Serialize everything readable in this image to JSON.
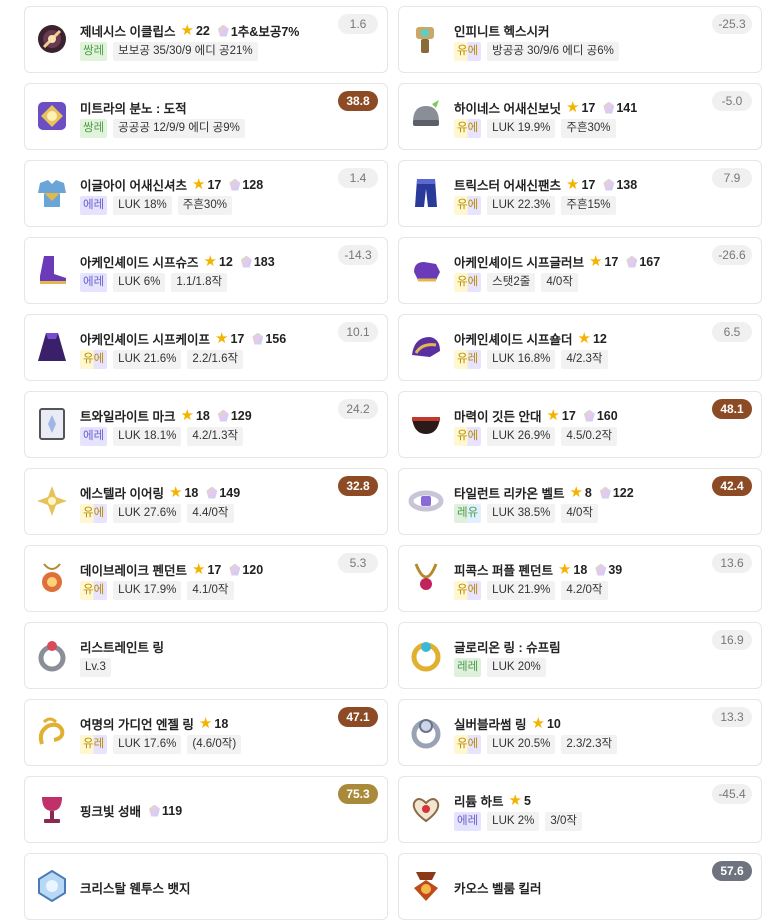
{
  "items": [
    {
      "name": "제네시스 이클립스",
      "star": "22",
      "potential": "1추&보공7%",
      "grade": "쌍레",
      "grade_class": "g-ssang",
      "tags": [
        "보보공 35/30/9 에디 공21%"
      ],
      "badge": "1.6",
      "badge_class": "b-grey",
      "icon": "dark-orb-icon"
    },
    {
      "name": "인피니트 헥스시커",
      "star": "",
      "potential": "",
      "grade": "유에",
      "grade_class": "g-yu",
      "tags": [
        "방공공 30/9/6 에디 공6%"
      ],
      "badge": "-25.3",
      "badge_class": "b-grey",
      "icon": "secondary-weapon-icon"
    },
    {
      "name": "미트라의 분노 : 도적",
      "star": "",
      "potential": "",
      "grade": "쌍레",
      "grade_class": "g-ssang",
      "tags": [
        "공공공 12/9/9 에디 공9%"
      ],
      "badge": "38.8",
      "badge_class": "b-brown",
      "icon": "emblem-icon"
    },
    {
      "name": "하이네스 어새신보닛",
      "star": "17",
      "potential": "141",
      "grade": "유에",
      "grade_class": "g-yu",
      "tags": [
        "LUK 19.9%",
        "주흔30%"
      ],
      "badge": "-5.0",
      "badge_class": "b-grey",
      "icon": "helmet-icon"
    },
    {
      "name": "이글아이 어새신셔츠",
      "star": "17",
      "potential": "128",
      "grade": "에레",
      "grade_class": "g-ep",
      "tags": [
        "LUK 18%",
        "주흔30%"
      ],
      "badge": "1.4",
      "badge_class": "b-grey",
      "icon": "shirt-icon"
    },
    {
      "name": "트릭스터 어새신팬츠",
      "star": "17",
      "potential": "138",
      "grade": "유에",
      "grade_class": "g-yu",
      "tags": [
        "LUK 22.3%",
        "주흔15%"
      ],
      "badge": "7.9",
      "badge_class": "b-grey",
      "icon": "pants-icon"
    },
    {
      "name": "아케인셰이드 시프슈즈",
      "star": "12",
      "potential": "183",
      "grade": "에레",
      "grade_class": "g-ep",
      "tags": [
        "LUK 6%",
        "1.1/1.8작"
      ],
      "badge": "-14.3",
      "badge_class": "b-grey",
      "icon": "shoes-icon"
    },
    {
      "name": "아케인셰이드 시프글러브",
      "star": "17",
      "potential": "167",
      "grade": "유에",
      "grade_class": "g-yu",
      "tags": [
        "스탯2줄",
        "4/0작"
      ],
      "badge": "-26.6",
      "badge_class": "b-grey",
      "icon": "glove-icon"
    },
    {
      "name": "아케인셰이드 시프케이프",
      "star": "17",
      "potential": "156",
      "grade": "유에",
      "grade_class": "g-yu",
      "tags": [
        "LUK 21.6%",
        "2.2/1.6작"
      ],
      "badge": "10.1",
      "badge_class": "b-grey",
      "icon": "cape-icon"
    },
    {
      "name": "아케인셰이드 시프숄더",
      "star": "12",
      "potential": "",
      "grade": "유레",
      "grade_class": "g-yu",
      "tags": [
        "LUK 16.8%",
        "4/2.3작"
      ],
      "badge": "6.5",
      "badge_class": "b-grey",
      "icon": "shoulder-icon"
    },
    {
      "name": "트와일라이트 마크",
      "star": "18",
      "potential": "129",
      "grade": "에레",
      "grade_class": "g-ep",
      "tags": [
        "LUK 18.1%",
        "4.2/1.3작"
      ],
      "badge": "24.2",
      "badge_class": "b-grey",
      "icon": "face-accessory-icon"
    },
    {
      "name": "마력이 깃든 안대",
      "star": "17",
      "potential": "160",
      "grade": "유에",
      "grade_class": "g-yu",
      "tags": [
        "LUK 26.9%",
        "4.5/0.2작"
      ],
      "badge": "48.1",
      "badge_class": "b-brown",
      "icon": "eyepatch-icon"
    },
    {
      "name": "에스텔라 이어링",
      "star": "18",
      "potential": "149",
      "grade": "유에",
      "grade_class": "g-yu",
      "tags": [
        "LUK 27.6%",
        "4.4/0작"
      ],
      "badge": "32.8",
      "badge_class": "b-brown",
      "icon": "earring-icon"
    },
    {
      "name": "타일런트 리카온 벨트",
      "star": "8",
      "potential": "122",
      "grade": "레유",
      "grade_class": "g-rele",
      "tags": [
        "LUK 38.5%",
        "4/0작"
      ],
      "badge": "42.4",
      "badge_class": "b-brown",
      "icon": "belt-icon"
    },
    {
      "name": "데이브레이크 펜던트",
      "star": "17",
      "potential": "120",
      "grade": "유에",
      "grade_class": "g-yu",
      "tags": [
        "LUK 17.9%",
        "4.1/0작"
      ],
      "badge": "5.3",
      "badge_class": "b-grey",
      "icon": "pendant-icon"
    },
    {
      "name": "피콕스 퍼플 펜던트",
      "star": "18",
      "potential": "39",
      "grade": "유에",
      "grade_class": "g-yu",
      "tags": [
        "LUK 21.9%",
        "4.2/0작"
      ],
      "badge": "13.6",
      "badge_class": "b-grey",
      "icon": "purple-pendant-icon"
    },
    {
      "name": "리스트레인트 링",
      "star": "",
      "potential": "",
      "grade": "",
      "grade_class": "",
      "tags": [
        "Lv.3"
      ],
      "badge": "",
      "badge_class": "",
      "icon": "ring-icon"
    },
    {
      "name": "글로리온 링 : 슈프림",
      "star": "",
      "potential": "",
      "grade": "레레",
      "grade_class": "g-re",
      "tags": [
        "LUK 20%"
      ],
      "badge": "16.9",
      "badge_class": "b-grey",
      "icon": "gold-ring-icon"
    },
    {
      "name": "여명의 가디언 엔젤 링",
      "star": "18",
      "potential": "",
      "grade": "유레",
      "grade_class": "g-yu",
      "tags": [
        "LUK 17.6%",
        "(4.6/0작)"
      ],
      "badge": "47.1",
      "badge_class": "b-brown",
      "icon": "angel-ring-icon"
    },
    {
      "name": "실버블라썸 링",
      "star": "10",
      "potential": "",
      "grade": "유에",
      "grade_class": "g-yu",
      "tags": [
        "LUK 20.5%",
        "2.3/2.3작"
      ],
      "badge": "13.3",
      "badge_class": "b-grey",
      "icon": "silver-ring-icon"
    },
    {
      "name": "핑크빛 성배",
      "star": "",
      "potential": "119",
      "grade": "",
      "grade_class": "",
      "tags": [],
      "badge": "75.3",
      "badge_class": "b-gold",
      "icon": "chalice-icon"
    },
    {
      "name": "리튬 하트",
      "star": "5",
      "potential": "",
      "grade": "에레",
      "grade_class": "g-ep",
      "tags": [
        "LUK 2%",
        "3/0작"
      ],
      "badge": "-45.4",
      "badge_class": "b-grey",
      "icon": "heart-icon"
    },
    {
      "name": "크리스탈 웬투스 뱃지",
      "star": "",
      "potential": "",
      "grade": "",
      "grade_class": "",
      "tags": [],
      "badge": "",
      "badge_class": "",
      "icon": "badge-icon"
    },
    {
      "name": "카오스 벨룸 킬러",
      "star": "",
      "potential": "",
      "grade": "",
      "grade_class": "",
      "tags": [],
      "badge": "57.6",
      "badge_class": "b-slate",
      "icon": "medal-icon"
    }
  ]
}
